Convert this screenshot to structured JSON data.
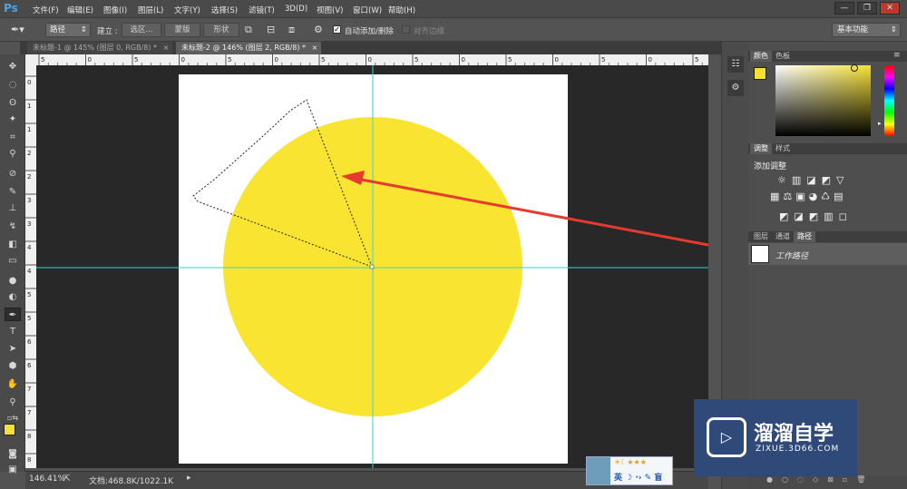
{
  "app": {
    "logo": "Ps"
  },
  "menu": [
    "文件(F)",
    "编辑(E)",
    "图像(I)",
    "图层(L)",
    "文字(Y)",
    "选择(S)",
    "滤镜(T)",
    "3D(D)",
    "视图(V)",
    "窗口(W)",
    "帮助(H)"
  ],
  "window_controls": [
    "—",
    "❐",
    "✕"
  ],
  "options": {
    "mode_value": "路径",
    "build_label": "建立 :",
    "selection_btn": "选区...",
    "mask_btn": "蒙版",
    "shape_btn": "形状",
    "auto_add_delete": "自动添加/删除",
    "align_edges": "对齐边缘",
    "workspace_value": "基本功能"
  },
  "doc_tabs": [
    {
      "label": "未标题-1 @ 145% (图层 0, RGB/8) *",
      "close": "×"
    },
    {
      "label": "未标题-2 @ 146% (图层 2, RGB/8) *",
      "close": "×"
    }
  ],
  "ruler_h_labels": [
    "5",
    "0",
    "5",
    "0",
    "5",
    "0",
    "5",
    "0",
    "5",
    "0",
    "5",
    "0",
    "5",
    "0",
    "5"
  ],
  "ruler_v_labels": [
    "0",
    "1",
    "1",
    "2",
    "2",
    "3",
    "3",
    "4",
    "4",
    "5",
    "5",
    "6",
    "6",
    "7",
    "7",
    "8",
    "8"
  ],
  "status": {
    "zoom": "146.41%",
    "doc": "文档:468.8K/1022.1K"
  },
  "color_panel": {
    "tabs": [
      "颜色",
      "色板"
    ],
    "fg": "#f6e132",
    "bg": "#ffffff"
  },
  "adjust_panel": {
    "tabs": [
      "调整",
      "样式"
    ],
    "title": "添加调整"
  },
  "paths_panel": {
    "tabs": [
      "图层",
      "通道",
      "路径"
    ],
    "item": "工作路径"
  },
  "watermark": {
    "title": "溜溜自学",
    "url": "ZIXUE.3D66.COM"
  },
  "ime": {
    "text": "英 ☽ ·› ✎ 盲"
  },
  "colors": {
    "circle": "#f9e531",
    "guide": "#2fd6d6",
    "arrow": "#e63a30"
  }
}
